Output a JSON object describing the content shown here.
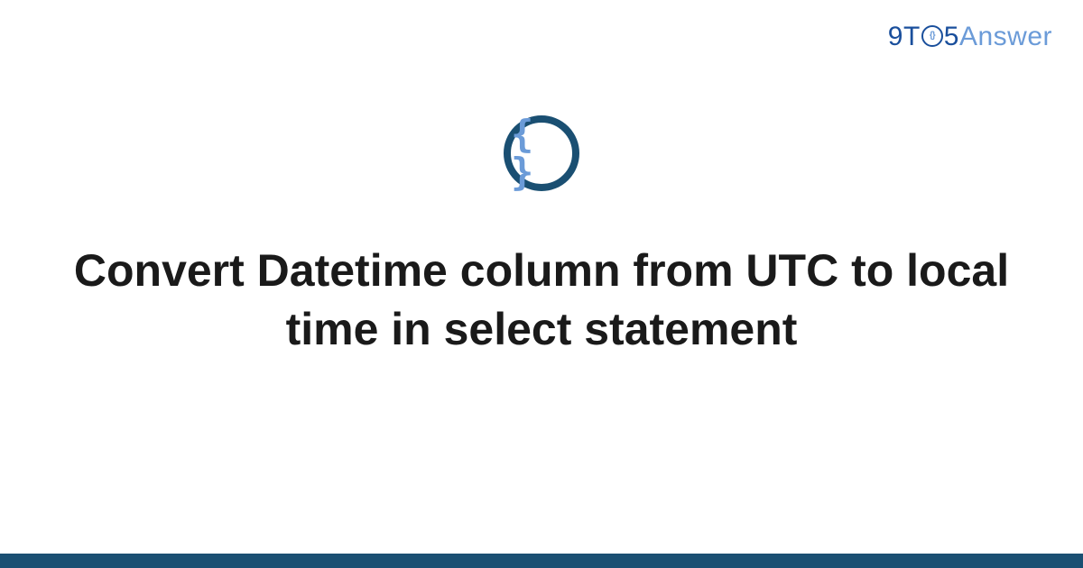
{
  "brand": {
    "nine": "9",
    "t": "T",
    "o_inner": "{}",
    "five": "5",
    "answer": "Answer"
  },
  "icon": {
    "braces": "{ }"
  },
  "title": "Convert Datetime column from UTC to local time in select statement"
}
